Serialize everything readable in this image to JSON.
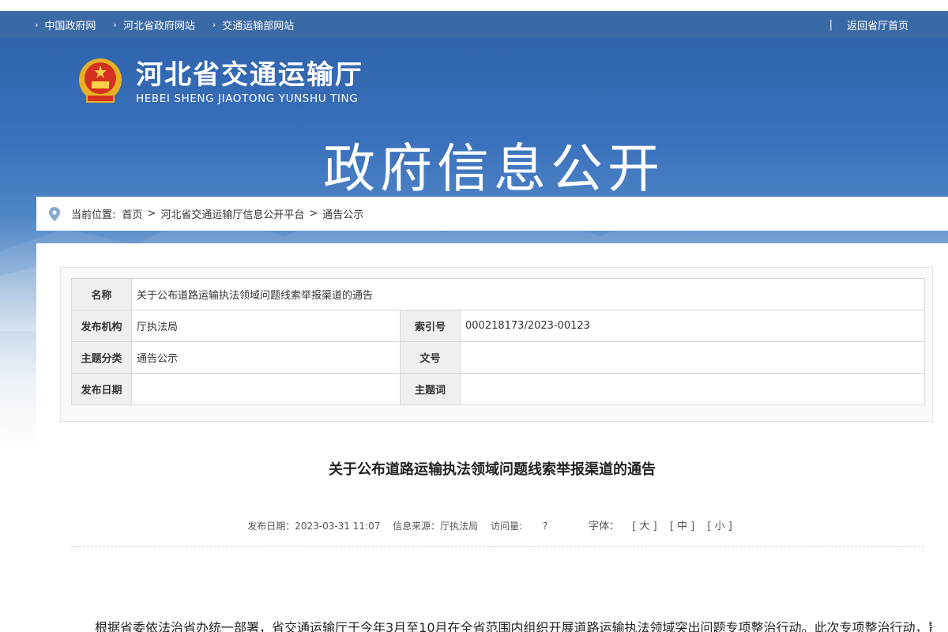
{
  "topbar": {
    "links": [
      "中国政府网",
      "河北省政府网站",
      "交通运输部网站"
    ],
    "separator": "|",
    "home_link": "返回省厅首页"
  },
  "site": {
    "title_cn": "河北省交通运输厅",
    "title_en": "HEBEI SHENG JIAOTONG YUNSHU TING",
    "emblem_icon": "national-emblem-icon"
  },
  "banner": {
    "title": "政府信息公开"
  },
  "breadcrumb": {
    "icon": "location-pin-icon",
    "prefix": "当前位置:",
    "items": [
      "首页",
      "河北省交通运输厅信息公开平台",
      "通告公示"
    ],
    "sep": ">"
  },
  "info_table": {
    "name_label": "名称",
    "name_value": "关于公布道路运输执法领域问题线索举报渠道的通告",
    "publisher_label": "发布机构",
    "publisher_value": "厅执法局",
    "index_label": "索引号",
    "index_value": "000218173/2023-00123",
    "category_label": "主题分类",
    "category_value": "通告公示",
    "doc_no_label": "文号",
    "doc_no_value": "",
    "date_label": "发布日期",
    "date_value": "",
    "keywords_label": "主题词",
    "keywords_value": ""
  },
  "article": {
    "title": "关于公布道路运输执法领域问题线索举报渠道的通告",
    "meta_date": "发布日期：2023-03-31 11:07",
    "meta_source": "信息来源：厅执法局",
    "meta_visits_label": "访问量:",
    "meta_visits_value": "?",
    "font_label": "字体：",
    "font_large": "[ 大 ]",
    "font_medium": "[ 中 ]",
    "font_small": "[ 小 ]",
    "body_first_line": "根据省委依法治省办统一部署，省交通运输厅于今年3月至10月在全省范围内组织开展道路运输执法领域突出问题专项整治行动。此次专项整治行动，旨"
  },
  "colors": {
    "topbar": "#3a6aa6",
    "banner": "#3b72bd",
    "emblem_gold": "#e8b023",
    "emblem_red": "#d6301f"
  }
}
